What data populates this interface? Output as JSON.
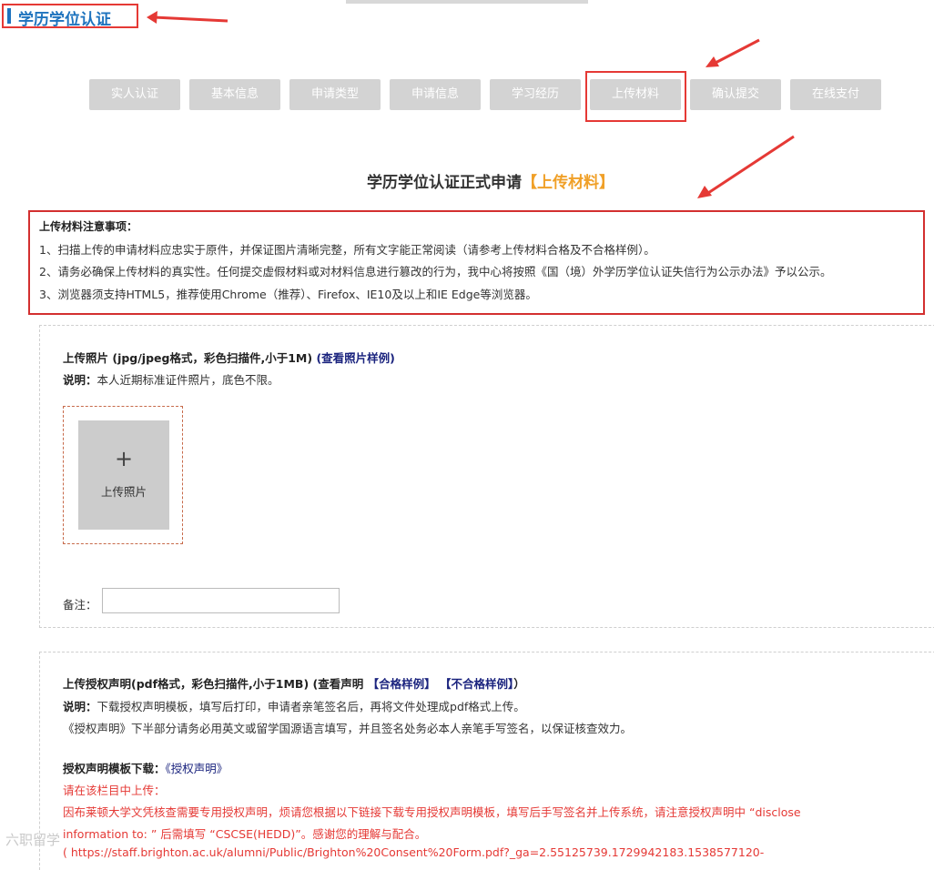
{
  "page_title": "学历学位认证",
  "steps": [
    {
      "label": "实人认证"
    },
    {
      "label": "基本信息"
    },
    {
      "label": "申请类型"
    },
    {
      "label": "申请信息"
    },
    {
      "label": "学习经历"
    },
    {
      "label": "上传材料"
    },
    {
      "label": "确认提交"
    },
    {
      "label": "在线支付"
    }
  ],
  "heading": {
    "text": "学历学位认证正式申请",
    "highlight": "【上传材料】"
  },
  "notice": {
    "title": "上传材料注意事项：",
    "lines": [
      "1、扫描上传的申请材料应忠实于原件，并保证图片清晰完整，所有文字能正常阅读（请参考上传材料合格及不合格样例）。",
      "2、请务必确保上传材料的真实性。任何提交虚假材料或对材料信息进行篡改的行为，我中心将按照《国（境）外学历学位认证失信行为公示办法》予以公示。",
      "3、浏览器须支持HTML5，推荐使用Chrome（推荐）、Firefox、IE10及以上和IE Edge等浏览器。"
    ]
  },
  "photo_section": {
    "title": "上传照片 (jpg/jpeg格式，彩色扫描件,小于1M)",
    "sample_link": "(查看照片样例)",
    "desc_label": "说明：",
    "desc_text": "本人近期标准证件照片，底色不限。",
    "upload_plus": "+",
    "upload_label": "上传照片",
    "remark_label": "备注：",
    "remark_value": ""
  },
  "auth_section": {
    "title": "上传授权声明(pdf格式，彩色扫描件,小于1MB) (查看声明",
    "ok_sample": "【合格样例】",
    "bad_sample": "【不合格样例】",
    "title_close": "）",
    "desc_label": "说明：",
    "desc_text": "下载授权声明模板，填写后打印，申请者亲笔签名后，再将文件处理成pdf格式上传。",
    "desc_line2": "《授权声明》下半部分请务必用英文或留学国源语言填写，并且签名处务必本人亲笔手写签名，以保证核查效力。",
    "template_label": "授权声明模板下载：",
    "template_link": "《授权声明》",
    "red_line1": "请在该栏目中上传：",
    "red_line2": "因布莱顿大学文凭核查需要专用授权声明，烦请您根据以下链接下载专用授权声明模板，填写后手写签名并上传系统，请注意授权声明中 “disclose",
    "red_line3": "information to: ” 后需填写 “CSCSE(HEDD)”。感谢您的理解与配合。",
    "red_line4": "( https://staff.brighton.ac.uk/alumni/Public/Brighton%20Consent%20Form.pdf?_ga=2.55125739.1729942183.1538577120-"
  },
  "watermark": "六职留学"
}
